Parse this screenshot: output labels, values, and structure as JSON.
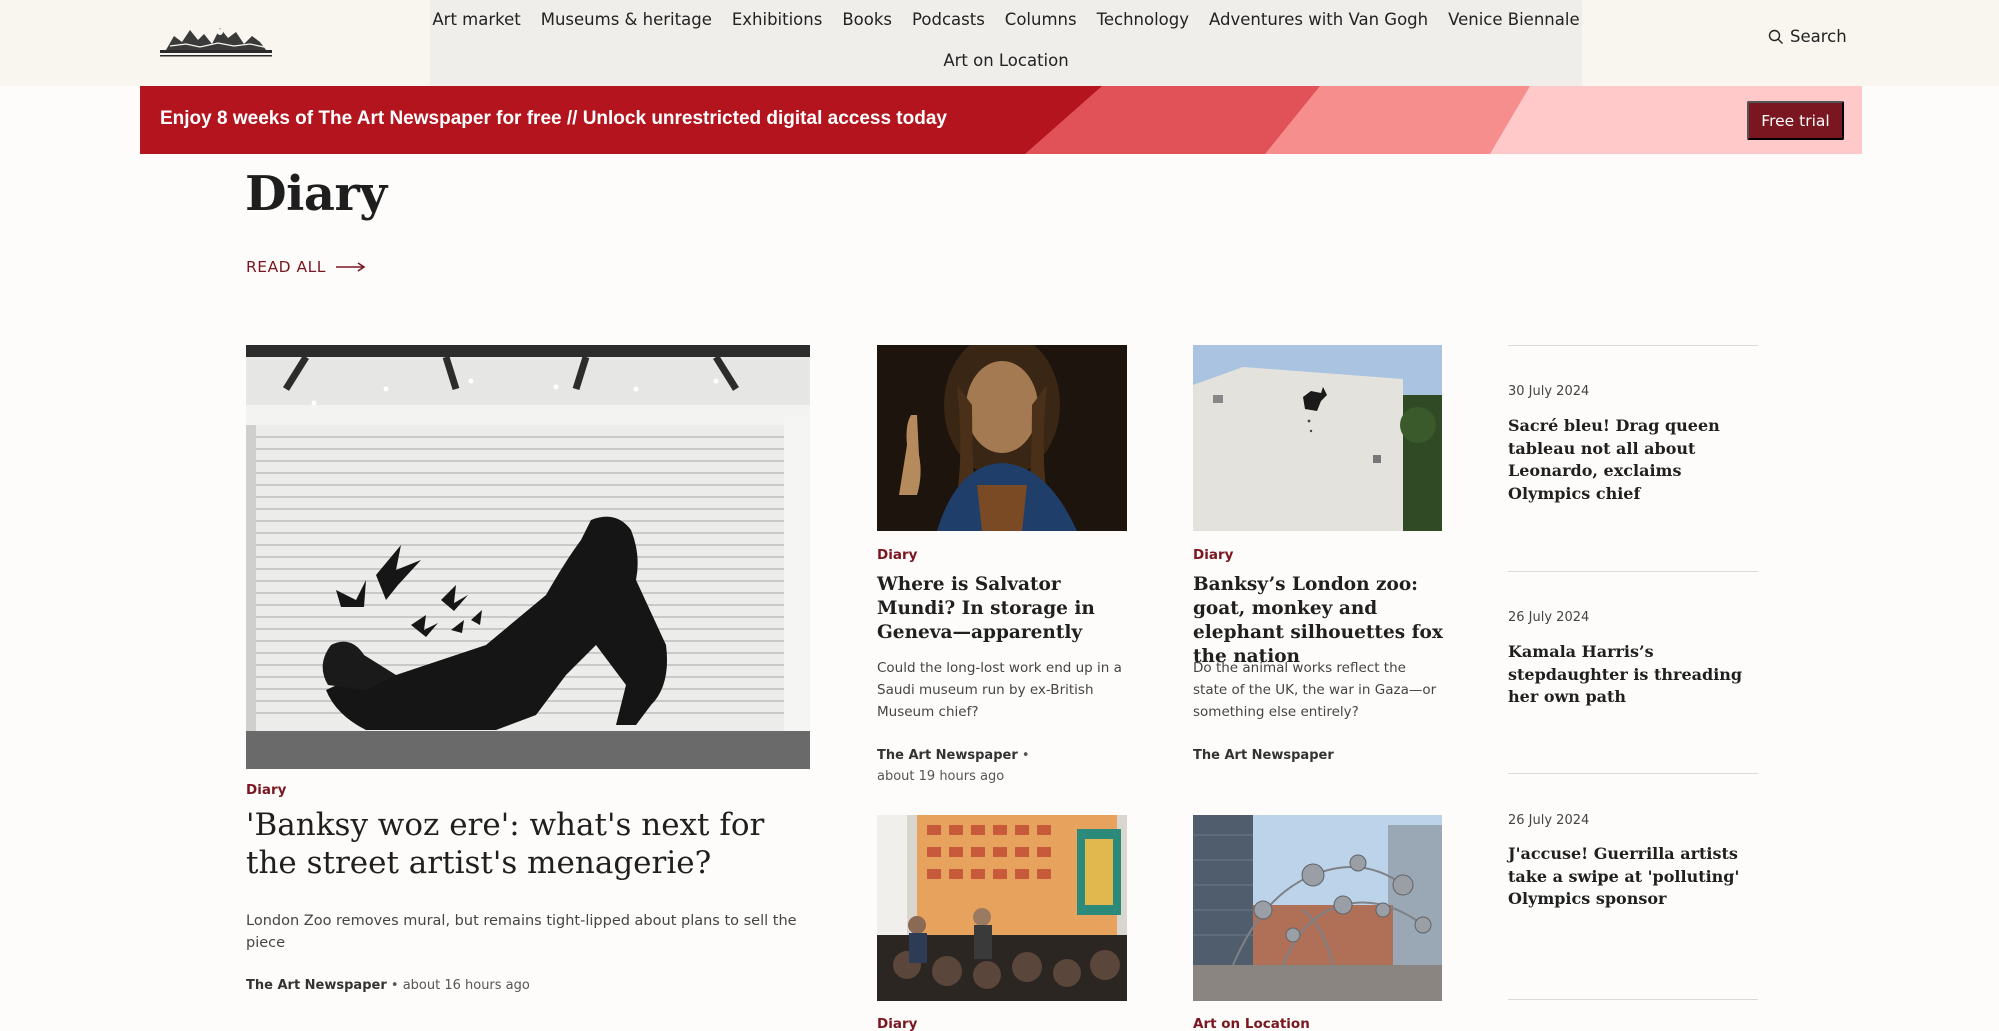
{
  "header": {
    "nav_row_1": [
      "Art market",
      "Museums & heritage",
      "Exhibitions",
      "Books",
      "Podcasts",
      "Columns",
      "Technology",
      "Adventures with Van Gogh",
      "Venice Biennale"
    ],
    "nav_row_2": [
      "Art on Location"
    ],
    "search_label": "Search",
    "logo_icon": "publication-logo-icon"
  },
  "promo": {
    "text": "Enjoy 8 weeks of The Art Newspaper for free // Unlock unrestricted digital access today",
    "button_label": "Free trial",
    "colors": {
      "dark": "#b3141e",
      "mid": "#e05258",
      "light": "#f68e8e",
      "pale": "#ffc9c9",
      "button": "#7a1620"
    }
  },
  "section": {
    "title": "Diary",
    "read_all_label": "READ ALL"
  },
  "lead_story": {
    "kicker": "Diary",
    "headline": "'Banksy woz ere': what's next for the street artist's menagerie?",
    "standfirst": "London Zoo removes mural, but remains tight-lipped about plans to sell the piece",
    "source": "The Art Newspaper",
    "time": "about 16 hours ago",
    "image": "banksy-gorilla-shutter-mural"
  },
  "grid_stories": [
    {
      "kicker": "Diary",
      "headline": "Where is Salvator Mundi? In storage in Geneva—apparently",
      "standfirst": "Could the long-lost work end up in a Saudi museum run by ex-British Museum chief?",
      "source": "The Art Newspaper",
      "time": "about 19 hours ago",
      "image": "salvator-mundi-painting"
    },
    {
      "kicker": "Diary",
      "headline": "Banksy’s London zoo: goat, monkey and elephant silhouettes fox the nation",
      "standfirst": "Do the animal works reflect the state of the UK, the war in Gaza—or something else entirely?",
      "source": "The Art Newspaper",
      "image": "banksy-goat-wall"
    },
    {
      "kicker": "Diary",
      "image": "gallery-talk-audience"
    },
    {
      "kicker": "Art on Location",
      "image": "steel-sphere-sculpture-plaza"
    }
  ],
  "sidebar": [
    {
      "date": "30 July 2024",
      "headline": "Sacré bleu! Drag queen tableau not all about Leonardo, exclaims Olympics chief"
    },
    {
      "date": "26 July 2024",
      "headline": "Kamala Harris’s stepdaughter is threading her own path"
    },
    {
      "date": "26 July 2024",
      "headline": "J'accuse! Guerrilla artists take a swipe at 'polluting' Olympics sponsor"
    }
  ],
  "icons": {
    "search": "search-icon",
    "arrow": "arrow-right-icon"
  },
  "colors": {
    "accent": "#7a1620",
    "background": "#fdfcfa",
    "header": "#f8f6ef"
  }
}
